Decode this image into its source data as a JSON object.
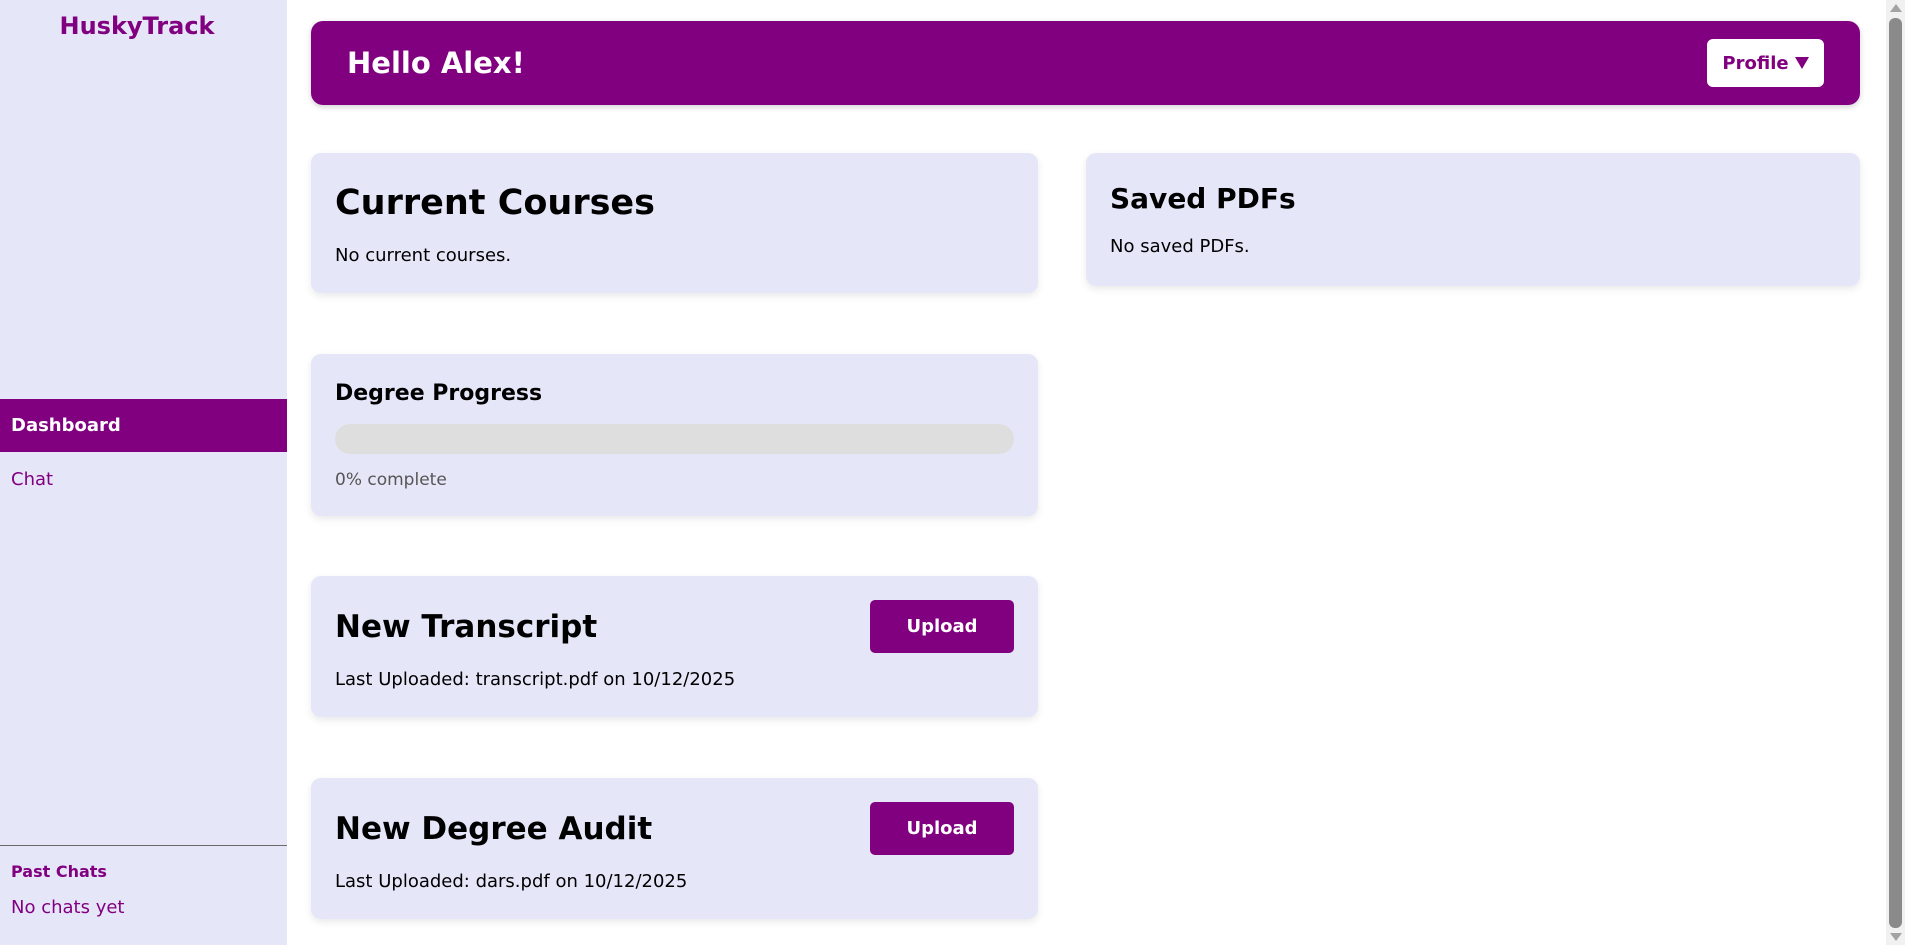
{
  "sidebar": {
    "brand": "HuskyTrack",
    "nav": [
      {
        "label": "Dashboard",
        "active": true
      },
      {
        "label": "Chat",
        "active": false
      }
    ],
    "past_chats": {
      "title": "Past Chats",
      "empty_text": "No chats yet"
    }
  },
  "header": {
    "greeting": "Hello Alex!",
    "profile_label": "Profile",
    "profile_icon": "caret-down-icon"
  },
  "cards": {
    "current_courses": {
      "title": "Current Courses",
      "empty_text": "No current courses."
    },
    "saved_pdfs": {
      "title": "Saved PDFs",
      "empty_text": "No saved PDFs."
    },
    "degree_progress": {
      "title": "Degree Progress",
      "percent": 0,
      "status_text": "0% complete"
    },
    "new_transcript": {
      "title": "New Transcript",
      "button_label": "Upload",
      "last_uploaded": "Last Uploaded: transcript.pdf on 10/12/2025"
    },
    "new_degree_audit": {
      "title": "New Degree Audit",
      "button_label": "Upload",
      "last_uploaded": "Last Uploaded: dars.pdf on 10/12/2025"
    }
  },
  "colors": {
    "accent": "#800080",
    "panel": "#e6e6f9",
    "progress_track": "#dedede"
  }
}
